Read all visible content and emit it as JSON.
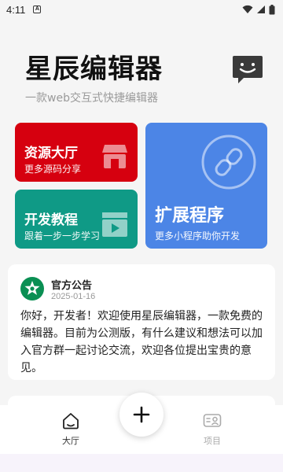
{
  "status_bar": {
    "time": "4:11",
    "notification_icon": "a-box-icon",
    "icons": [
      "wifi-icon",
      "signal-icon",
      "battery-icon"
    ]
  },
  "header": {
    "title": "星辰编辑器",
    "subtitle": "一款web交互式快捷编辑器",
    "message_icon": "chat-bubble-smile-icon"
  },
  "cards": {
    "resource": {
      "title": "资源大厅",
      "subtitle": "更多源码分享",
      "icon": "store-icon",
      "color": "#d6000f"
    },
    "dev": {
      "title": "开发教程",
      "subtitle": "跟着一步一步学习",
      "icon": "video-clapper-icon",
      "color": "#0f9a86"
    },
    "extension": {
      "title": "扩展程序",
      "subtitle": "更多小程序助你开发",
      "icon": "link-circle-icon",
      "color": "#4c85e6"
    }
  },
  "notice": {
    "author": "官方公告",
    "date": "2025-01-16",
    "body": "你好，开发者！欢迎使用星辰编辑器，一款免费的编辑器。目前为公测版，有什么建议和想法可以加入官方群一起讨论交流，欢迎各位提出宝贵的意见。",
    "avatar_icon": "star-badge-icon"
  },
  "bottom_nav": {
    "home_label": "大厅",
    "project_label": "项目",
    "fab_icon": "plus-icon"
  }
}
